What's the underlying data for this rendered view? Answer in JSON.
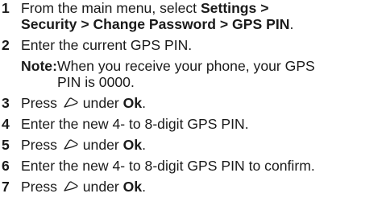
{
  "steps": [
    {
      "num": "1",
      "pre": "From the main menu, select ",
      "path1": "Settings >",
      "path2": "Security > Change Password > GPS PIN",
      "post": "."
    },
    {
      "num": "2",
      "text": "Enter the current GPS PIN."
    },
    {
      "num": "3",
      "pre": "Press ",
      "icon": "softkey-icon",
      "mid": " under ",
      "bold": "Ok",
      "post": "."
    },
    {
      "num": "4",
      "text": "Enter the new 4- to 8-digit GPS PIN."
    },
    {
      "num": "5",
      "pre": "Press ",
      "icon": "softkey-icon",
      "mid": " under ",
      "bold": "Ok",
      "post": "."
    },
    {
      "num": "6",
      "text": "Enter the new 4- to 8-digit GPS PIN to confirm."
    },
    {
      "num": "7",
      "pre": "Press ",
      "icon": "softkey-icon",
      "mid": " under ",
      "bold": "Ok",
      "post": "."
    }
  ],
  "note": {
    "label": "Note:",
    "line1": "When you receive your phone, your GPS",
    "line2": "PIN is 0000."
  }
}
